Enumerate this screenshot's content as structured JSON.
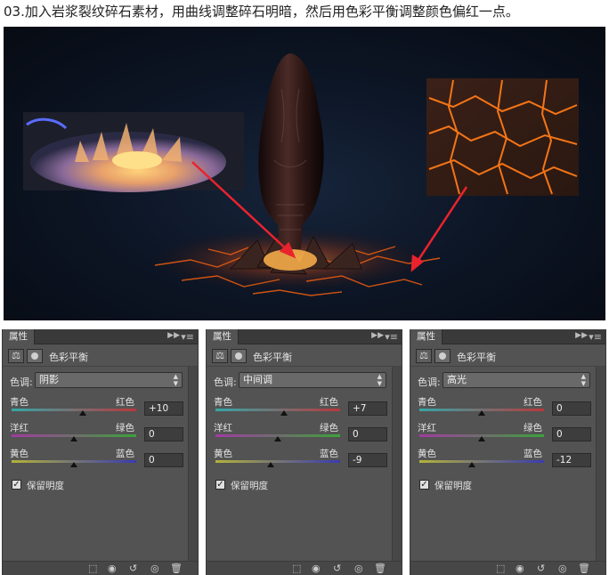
{
  "heading": "03.加入岩浆裂纹碎石素材，用曲线调整碎石明暗，然后用色彩平衡调整颜色偏红一点。",
  "colors": {
    "cyan_red_track": [
      "#35a7a7",
      "#b8383c"
    ],
    "magenta_green_track": [
      "#a23aa2",
      "#3ba23a"
    ],
    "yellow_blue_track": [
      "#b2b23a",
      "#3a3ab2"
    ]
  },
  "panels": [
    {
      "tab": "属性",
      "title": "色彩平衡",
      "tone_label": "色调:",
      "tone_value": "阴影",
      "rows": [
        {
          "left": "青色",
          "right": "红色",
          "value": "+10",
          "pos": 0.57
        },
        {
          "left": "洋红",
          "right": "绿色",
          "value": "0",
          "pos": 0.5
        },
        {
          "left": "黄色",
          "right": "蓝色",
          "value": "0",
          "pos": 0.5
        }
      ],
      "preserve_label": "保留明度",
      "preserve_checked": true
    },
    {
      "tab": "属性",
      "title": "色彩平衡",
      "tone_label": "色调:",
      "tone_value": "中间调",
      "rows": [
        {
          "left": "青色",
          "right": "红色",
          "value": "+7",
          "pos": 0.55
        },
        {
          "left": "洋红",
          "right": "绿色",
          "value": "0",
          "pos": 0.5
        },
        {
          "left": "黄色",
          "right": "蓝色",
          "value": "-9",
          "pos": 0.44
        }
      ],
      "preserve_label": "保留明度",
      "preserve_checked": true
    },
    {
      "tab": "属性",
      "title": "色彩平衡",
      "tone_label": "色调:",
      "tone_value": "高光",
      "rows": [
        {
          "left": "青色",
          "right": "红色",
          "value": "0",
          "pos": 0.5
        },
        {
          "left": "洋红",
          "right": "绿色",
          "value": "0",
          "pos": 0.5
        },
        {
          "left": "黄色",
          "right": "蓝色",
          "value": "-12",
          "pos": 0.42
        }
      ],
      "preserve_label": "保留明度",
      "preserve_checked": true
    }
  ]
}
